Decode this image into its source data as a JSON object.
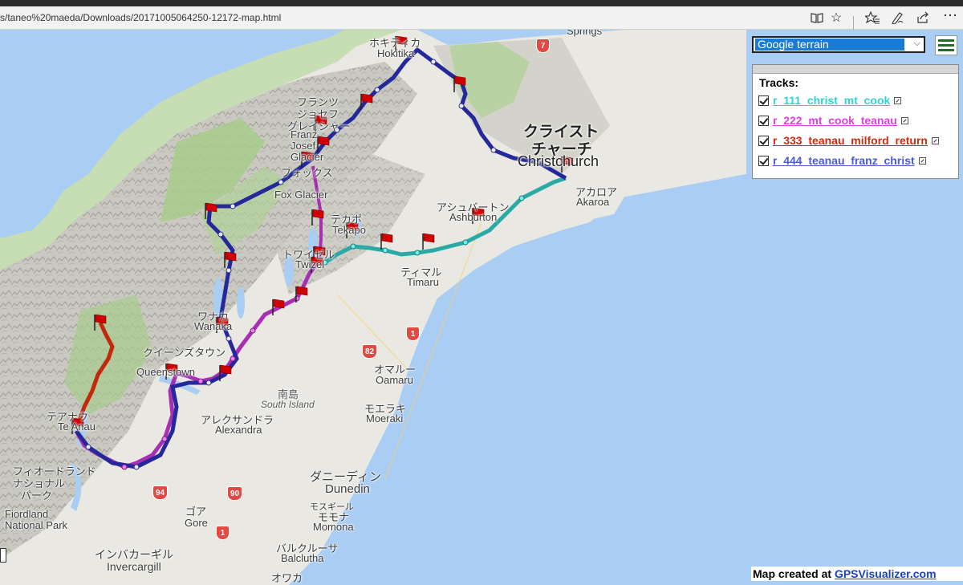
{
  "browser": {
    "address": "s/taneo%20maeda/Downloads/20171005064250-12172-map.html",
    "icons": [
      "reading-view-icon",
      "favorite-star-icon",
      "favorites-hub-icon",
      "pen-icon",
      "share-icon",
      "more-icon"
    ]
  },
  "map": {
    "map_type_selected": "Google terrain",
    "legend_title": "Tracks:",
    "tracks": [
      {
        "name": "r_111_christ_mt_cook",
        "color": "#2fd3cf",
        "line_color": "#2aa9a6",
        "checked": true
      },
      {
        "name": "r_222_mt_cook_teanau",
        "color": "#e040e0",
        "line_color": "#a72fb3",
        "checked": true
      },
      {
        "name": "r_333_teanau_milford_return",
        "color": "#d42a0c",
        "line_color": "#c2280b",
        "checked": true
      },
      {
        "name": "r_444_teanau_franz_christ",
        "color": "#4a5cd8",
        "line_color": "#24289a",
        "checked": true
      }
    ],
    "credit_prefix": "Map created at ",
    "credit_link": "GPSVisualizer.com",
    "labels": [
      {
        "jp": "ホキティカ",
        "en": "Hokitika"
      },
      {
        "jp": "フランツ",
        "en": ""
      },
      {
        "jp": "ジョセフ",
        "en": ""
      },
      {
        "jp": "グレイシャー",
        "en": "Franz Josef Glacier"
      },
      {
        "jp": "クライスト",
        "en": ""
      },
      {
        "jp": "チャーチ",
        "en": "Christchurch"
      },
      {
        "jp": "アカロア",
        "en": "Akaroa"
      },
      {
        "jp": "アシュバートン",
        "en": "Ashburton"
      },
      {
        "jp": "フォックス",
        "en": "Fox Glacier"
      },
      {
        "jp": "テカポ",
        "en": "Tekapo"
      },
      {
        "jp": "トワイゼル",
        "en": "Twizel"
      },
      {
        "jp": "ティマル",
        "en": "Timaru"
      },
      {
        "jp": "ワナカ",
        "en": "Wanaka"
      },
      {
        "jp": "クイーンズタウン",
        "en": "Queenstown"
      },
      {
        "jp": "テアナウ",
        "en": "Te Anau"
      },
      {
        "jp": "オマルー",
        "en": "Oamaru"
      },
      {
        "jp": "モエラキ",
        "en": "Moeraki"
      },
      {
        "jp": "南島",
        "en": "South Island"
      },
      {
        "jp": "アレクサンドラ",
        "en": "Alexandra"
      },
      {
        "jp": "ダニーディン",
        "en": "Dunedin"
      },
      {
        "jp": "フィオードランド",
        "en": ""
      },
      {
        "jp": "ナショナル",
        "en": ""
      },
      {
        "jp": "パーク",
        "en": "Fiordland National Park"
      },
      {
        "jp": "ゴア",
        "en": "Gore"
      },
      {
        "jp": "モスギール",
        "en": "Mosgiel"
      },
      {
        "jp": "モモナ",
        "en": "Momona"
      },
      {
        "jp": "インバカーギル",
        "en": "Invercargill"
      },
      {
        "jp": "バルクルーサ",
        "en": "Balclutha"
      },
      {
        "jp": "オワカ",
        "en": ""
      },
      {
        "jp": "",
        "en": "Springs"
      }
    ],
    "road_shields": [
      "7",
      "1",
      "82",
      "94",
      "90",
      "1"
    ]
  }
}
